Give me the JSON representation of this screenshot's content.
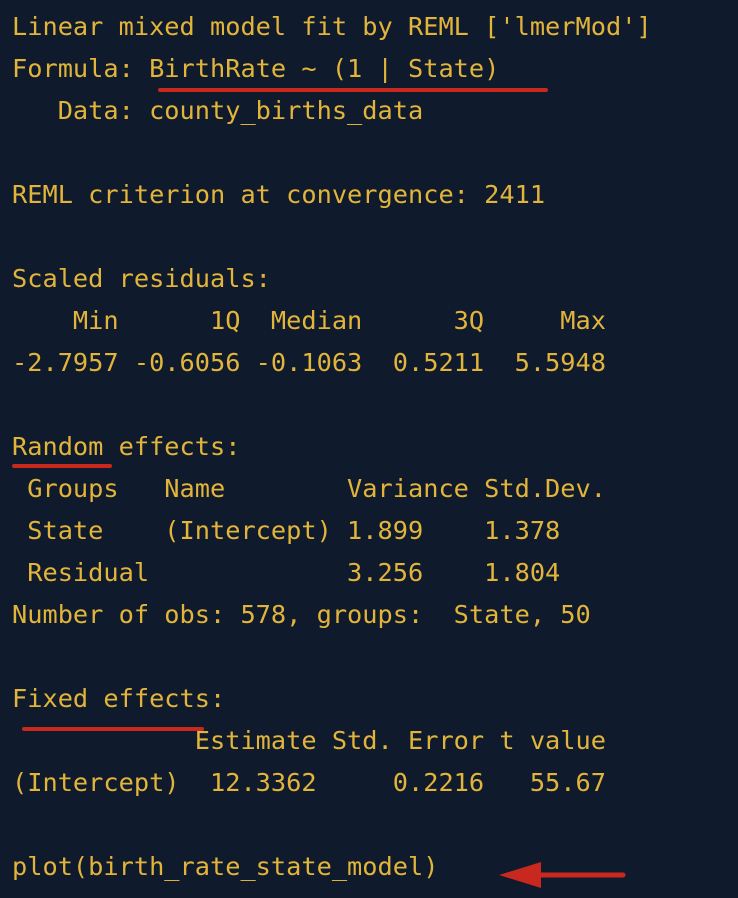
{
  "console": {
    "header_line": "Linear mixed model fit by REML ['lmerMod']",
    "formula_line": "Formula: BirthRate ~ (1 | State)",
    "data_line": "   Data: county_births_data",
    "reml_line": "REML criterion at convergence: 2411",
    "scaled_residuals": {
      "title": "Scaled residuals:",
      "header_row": "    Min      1Q  Median      3Q     Max ",
      "values_row": "-2.7957 -0.6056 -0.1063  0.5211  5.5948 "
    },
    "random_effects": {
      "title": "Random effects:",
      "header_row": " Groups   Name        Variance Std.Dev.",
      "rows": [
        " State    (Intercept) 1.899    1.378   ",
        " Residual             3.256    1.804   "
      ],
      "obs_line": "Number of obs: 578, groups:  State, 50"
    },
    "fixed_effects": {
      "title": "Fixed effects:",
      "header_row": "            Estimate Std. Error t value",
      "row": "(Intercept)  12.3362     0.2216   55.67"
    },
    "command": "plot(birth_rate_state_model)"
  },
  "annotation_color": "#c8281e",
  "text_color": "#e2b43a",
  "background_color": "#0f1b2d"
}
